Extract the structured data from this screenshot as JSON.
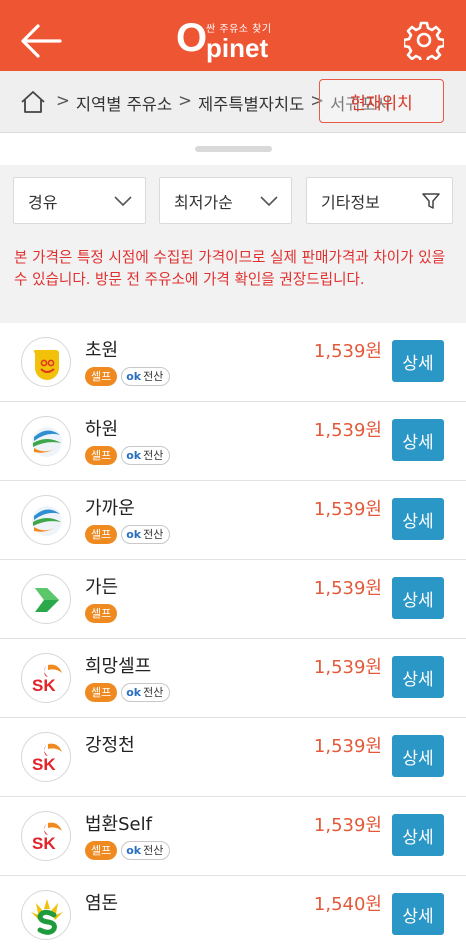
{
  "header": {
    "logo_tag": "싼 주유소 찾기",
    "logo_o": "O",
    "logo_rest": "pinet",
    "bg_color": "#ee5533",
    "back_icon": "arrow-left-icon",
    "settings_icon": "gear-icon"
  },
  "breadcrumb": {
    "home_icon": "home-icon",
    "items": [
      "지역별 주유소",
      "제주특별자치도",
      "서귀포시"
    ],
    "separator": ">",
    "location_button": "현재위치"
  },
  "filters": {
    "fuel": "경유",
    "sort": "최저가순",
    "extra": "기타정보"
  },
  "notice": "본 가격은 특정 시점에 수집된 가격이므로 실제 판매가격과 차이가 있을 수 있습니다. 방문 전 주유소에 가격 확인을 권장드립니다.",
  "badge_labels": {
    "self": "셀프",
    "pos_ok": "ok",
    "pos": "전산"
  },
  "detail_label": "상세",
  "stations": [
    {
      "name": "초원",
      "brand": "S-OIL",
      "price": "1,539원",
      "self": true,
      "pos": true
    },
    {
      "name": "하원",
      "brand": "GS칼텍스",
      "price": "1,539원",
      "self": true,
      "pos": true
    },
    {
      "name": "가까운",
      "brand": "GS칼텍스",
      "price": "1,539원",
      "self": true,
      "pos": true
    },
    {
      "name": "가든",
      "brand": "알뜰주유소",
      "price": "1,539원",
      "self": true,
      "pos": false
    },
    {
      "name": "희망셀프",
      "brand": "SK에너지",
      "price": "1,539원",
      "self": true,
      "pos": true
    },
    {
      "name": "강정천",
      "brand": "SK에너지",
      "price": "1,539원",
      "self": false,
      "pos": false
    },
    {
      "name": "법환Self",
      "brand": "SK에너지",
      "price": "1,539원",
      "self": true,
      "pos": true
    },
    {
      "name": "염돈",
      "brand": "현대오일뱅크",
      "price": "1,540원",
      "self": false,
      "pos": false
    }
  ],
  "colors": {
    "accent": "#ee5533",
    "price": "#e35a3a",
    "detail_button": "#2a97c6",
    "self_badge": "#ef8a20",
    "notice_text": "#e03030"
  }
}
